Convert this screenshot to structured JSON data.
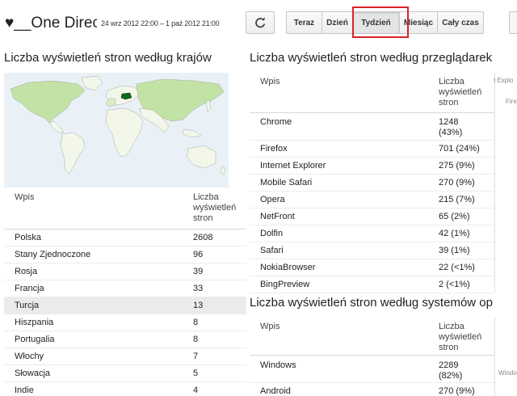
{
  "header": {
    "blog_title": "♥__One Direct",
    "date_range": "24 wrz 2012 22:00 – 1 paź 2012 21:00",
    "periods": [
      "Teraz",
      "Dzień",
      "Tydzień",
      "Miesiąc",
      "Cały czas"
    ],
    "active_period": "Tydzień"
  },
  "countries": {
    "title": "Liczba wyświetleń stron według krajów",
    "col_entry": "Wpis",
    "col_views": "Liczba wyświetleń stron",
    "rows": [
      {
        "name": "Polska",
        "value": "2608"
      },
      {
        "name": "Stany Zjednoczone",
        "value": "96"
      },
      {
        "name": "Rosja",
        "value": "39"
      },
      {
        "name": "Francja",
        "value": "33"
      },
      {
        "name": "Turcja",
        "value": "13"
      },
      {
        "name": "Hiszpania",
        "value": "8"
      },
      {
        "name": "Portugalia",
        "value": "8"
      },
      {
        "name": "Włochy",
        "value": "7"
      },
      {
        "name": "Słowacja",
        "value": "5"
      },
      {
        "name": "Indie",
        "value": "4"
      }
    ]
  },
  "browsers": {
    "title": "Liczba wyświetleń stron według przeglądarek",
    "col_entry": "Wpis",
    "col_views": "Liczba wyświetleń stron",
    "rows": [
      {
        "name": "Chrome",
        "value": "1248 (43%)"
      },
      {
        "name": "Firefox",
        "value": "701 (24%)"
      },
      {
        "name": "Internet Explorer",
        "value": "275 (9%)"
      },
      {
        "name": "Mobile Safari",
        "value": "270 (9%)"
      },
      {
        "name": "Opera",
        "value": "215 (7%)"
      },
      {
        "name": "NetFront",
        "value": "65 (2%)"
      },
      {
        "name": "Dolfin",
        "value": "42 (1%)"
      },
      {
        "name": "Safari",
        "value": "39 (1%)"
      },
      {
        "name": "NokiaBrowser",
        "value": "22 (<1%)"
      },
      {
        "name": "BingPreview",
        "value": "2 (<1%)"
      }
    ],
    "side_labels": [
      "t Explo",
      "Fire"
    ]
  },
  "os": {
    "title": "Liczba wyświetleń stron według systemów op",
    "col_entry": "Wpis",
    "col_views": "Liczba wyświetleń stron",
    "rows": [
      {
        "name": "Windows",
        "value": "2289 (82%)"
      },
      {
        "name": "Android",
        "value": "270 (9%)"
      }
    ],
    "side_labels": [
      "Windo"
    ]
  },
  "colors": {
    "highlight_box": "#d8232a",
    "map_water": "#e9f1f7",
    "map_land": "#f2f7ea",
    "map_top_country": "#0b6b1c",
    "map_light_country": "#c3e2a6"
  },
  "icons": {
    "refresh": "refresh-icon"
  }
}
